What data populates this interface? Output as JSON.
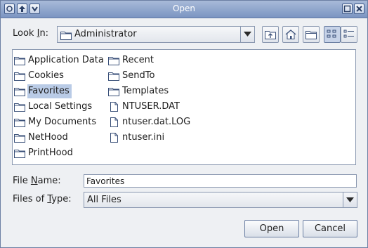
{
  "window": {
    "title": "Open"
  },
  "look_in": {
    "label_prefix": "Look ",
    "label_mnemonic": "I",
    "label_suffix": "n:",
    "value": "Administrator"
  },
  "files": [
    {
      "name": "Application Data",
      "type": "folder"
    },
    {
      "name": "Cookies",
      "type": "folder"
    },
    {
      "name": "Favorites",
      "type": "folder",
      "selected": true
    },
    {
      "name": "Local Settings",
      "type": "folder"
    },
    {
      "name": "My Documents",
      "type": "folder"
    },
    {
      "name": "NetHood",
      "type": "folder"
    },
    {
      "name": "PrintHood",
      "type": "folder"
    },
    {
      "name": "Recent",
      "type": "folder"
    },
    {
      "name": "SendTo",
      "type": "folder"
    },
    {
      "name": "Templates",
      "type": "folder"
    },
    {
      "name": "NTUSER.DAT",
      "type": "file"
    },
    {
      "name": "ntuser.dat.LOG",
      "type": "file"
    },
    {
      "name": "ntuser.ini",
      "type": "file"
    }
  ],
  "file_name": {
    "label_prefix": "File ",
    "label_mnemonic": "N",
    "label_suffix": "ame:",
    "value": "Favorites"
  },
  "files_of_type": {
    "label_prefix": "Files of ",
    "label_mnemonic": "T",
    "label_suffix": "ype:",
    "value": "All Files"
  },
  "buttons": {
    "open": "Open",
    "cancel": "Cancel"
  },
  "colors": {
    "titlebar": "#8fa5cc",
    "selection": "#b9cbe6",
    "border": "#8a98b0"
  }
}
